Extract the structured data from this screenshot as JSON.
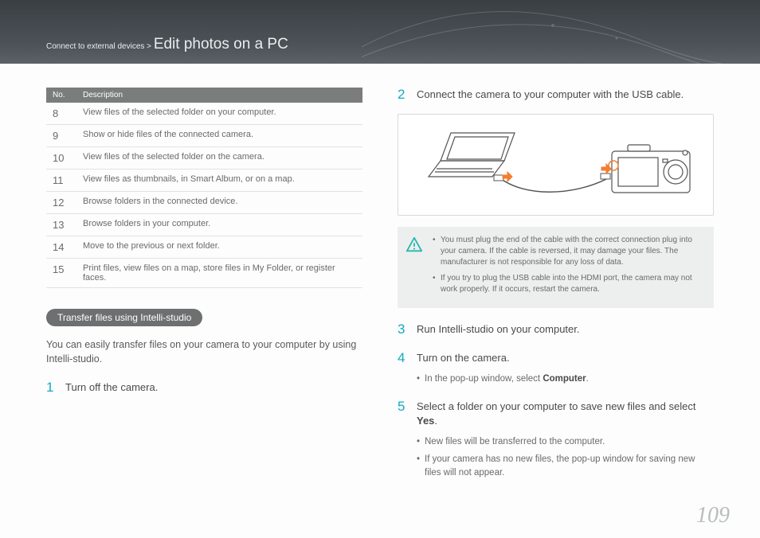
{
  "breadcrumb": {
    "section": "Connect to external devices > ",
    "title": "Edit photos on a PC"
  },
  "table": {
    "head": {
      "no": "No.",
      "desc": "Description"
    },
    "rows": [
      {
        "no": "8",
        "desc": "View files of the selected folder on your computer."
      },
      {
        "no": "9",
        "desc": "Show or hide files of the connected camera."
      },
      {
        "no": "10",
        "desc": "View files of the selected folder on the camera."
      },
      {
        "no": "11",
        "desc": "View files as thumbnails, in Smart Album, or on a map."
      },
      {
        "no": "12",
        "desc": "Browse folders in the connected device."
      },
      {
        "no": "13",
        "desc": "Browse folders in your computer."
      },
      {
        "no": "14",
        "desc": "Move to the previous or next folder."
      },
      {
        "no": "15",
        "desc": "Print files, view files on a map, store files in My Folder, or register faces."
      }
    ]
  },
  "pill": "Transfer files using Intelli-studio",
  "intro": "You can easily transfer files on your camera to your computer by using Intelli-studio.",
  "steps": {
    "s1": {
      "num": "1",
      "text": "Turn off the camera."
    },
    "s2": {
      "num": "2",
      "text": "Connect the camera to your computer with the USB cable."
    },
    "s3": {
      "num": "3",
      "text": "Run Intelli-studio on your computer."
    },
    "s4": {
      "num": "4",
      "text_a": "Turn on the camera.",
      "sub_a": "In the pop-up window, select ",
      "sub_a_bold": "Computer",
      "sub_a_end": "."
    },
    "s5": {
      "num": "5",
      "text_a": "Select a folder on your computer to save new files and select ",
      "text_bold": "Yes",
      "text_end": ".",
      "sub1": "New files will be transferred to the computer.",
      "sub2": "If your camera has no new files, the pop-up window for saving new files will not appear."
    }
  },
  "note": {
    "n1": "You must plug the end of the cable with the correct connection plug into your camera. If the cable is reversed, it may damage your files. The manufacturer is not responsible for any loss of data.",
    "n2": "If you try to plug the USB cable into the HDMI port, the camera may not work properly. If it occurs, restart the camera."
  },
  "pagenum": "109"
}
